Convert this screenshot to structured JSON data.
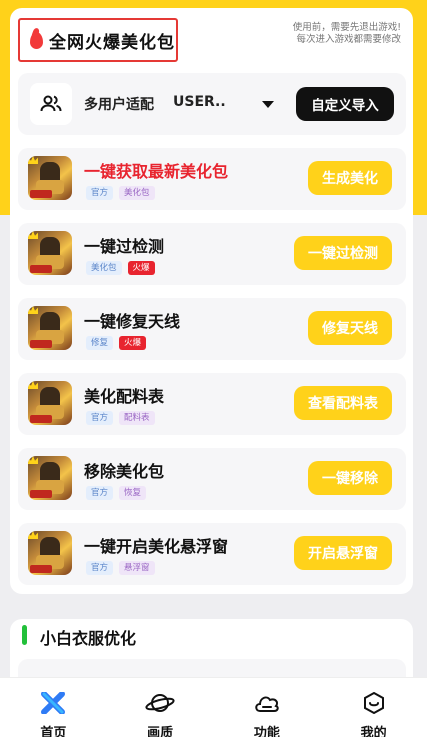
{
  "header": {
    "title": "全网火爆美化包",
    "notice_line1": "使用前，需要先退出游戏!",
    "notice_line2": "每次进入游戏都需要修改"
  },
  "user_row": {
    "label": "多用户适配",
    "selected": "USER..",
    "import_label": "自定义导入"
  },
  "rows": [
    {
      "title": "一键获取最新美化包",
      "tags": [
        "官方",
        "美化包"
      ],
      "button": "生成美化"
    },
    {
      "title": "一键过检测",
      "tags": [
        "美化包",
        "火爆"
      ],
      "button": "一键过检测"
    },
    {
      "title": "一键修复天线",
      "tags": [
        "修复",
        "火爆"
      ],
      "button": "修复天线"
    },
    {
      "title": "美化配料表",
      "tags": [
        "官方",
        "配料表"
      ],
      "button": "查看配料表"
    },
    {
      "title": "移除美化包",
      "tags": [
        "官方",
        "恢复"
      ],
      "button": "一键移除"
    },
    {
      "title": "一键开启美化悬浮窗",
      "tags": [
        "官方",
        "悬浮窗"
      ],
      "button": "开启悬浮窗"
    }
  ],
  "section": {
    "title": "小白衣服优化"
  },
  "tabbar": {
    "items": [
      {
        "label": "首页",
        "icon": "home-icon"
      },
      {
        "label": "画质",
        "icon": "planet-icon"
      },
      {
        "label": "功能",
        "icon": "cloud-icon"
      },
      {
        "label": "我的",
        "icon": "profile-icon"
      }
    ]
  },
  "colors": {
    "accent_yellow": "#ffd21a",
    "hot_red": "#e8242f",
    "section_green": "#22c03a"
  }
}
